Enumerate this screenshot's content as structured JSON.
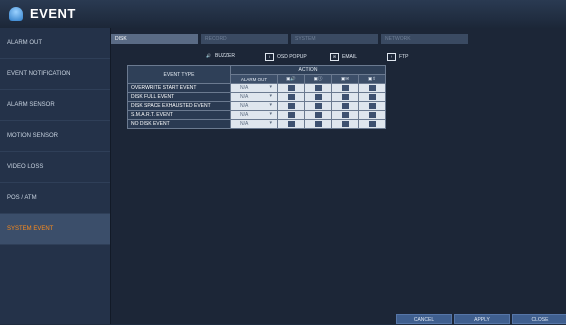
{
  "title": "EVENT",
  "sidebar": {
    "items": [
      {
        "label": "ALARM OUT"
      },
      {
        "label": "EVENT NOTIFICATION"
      },
      {
        "label": "ALARM SENSOR"
      },
      {
        "label": "MOTION SENSOR"
      },
      {
        "label": "VIDEO LOSS"
      },
      {
        "label": "POS / ATM"
      },
      {
        "label": "SYSTEM EVENT"
      }
    ],
    "active_index": 6
  },
  "tabs": [
    {
      "label": "DISK"
    },
    {
      "label": "RECORD"
    },
    {
      "label": "SYSTEM"
    },
    {
      "label": "NETWORK"
    }
  ],
  "legend": {
    "buzzer": "BUZZER",
    "osd_popup": "OSD POPUP",
    "email": "EMAIL",
    "ftp": "FTP"
  },
  "table": {
    "header_event_type": "EVENT TYPE",
    "header_action": "ACTION",
    "header_alarm_out": "ALARM OUT",
    "rows": [
      {
        "event": "OVERWRITE START EVENT",
        "alarm_out": "N/A"
      },
      {
        "event": "DISK FULL EVENT",
        "alarm_out": "N/A"
      },
      {
        "event": "DISK SPACE EXHAUSTED EVENT",
        "alarm_out": "N/A"
      },
      {
        "event": "S.M.A.R.T. EVENT",
        "alarm_out": "N/A"
      },
      {
        "event": "NO DISK EVENT",
        "alarm_out": "N/A"
      }
    ]
  },
  "buttons": {
    "cancel": "CANCEL",
    "apply": "APPLY",
    "close": "CLOSE"
  },
  "colors": {
    "active_menu": "#ff8c1a",
    "panel": "#1c2637",
    "button": "#3f5f8f"
  }
}
